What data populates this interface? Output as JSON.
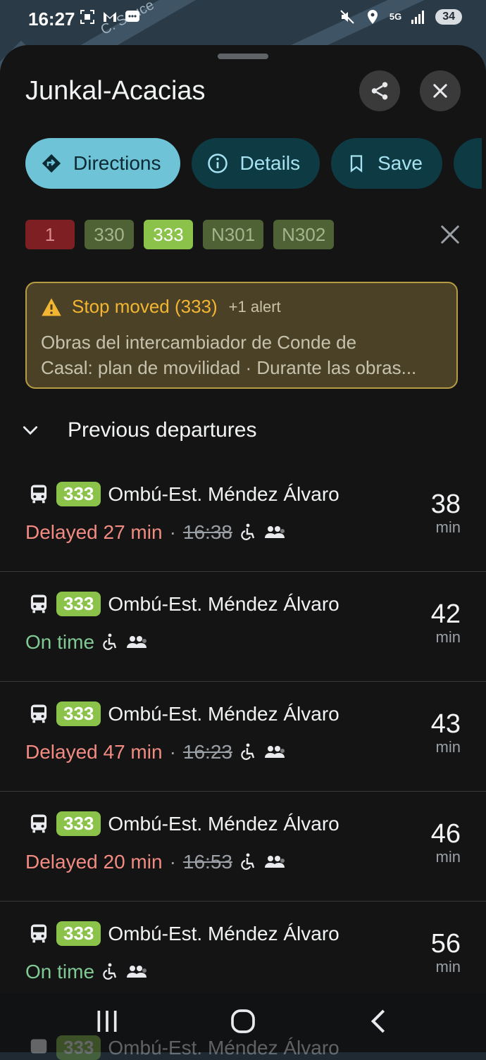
{
  "status_bar": {
    "time": "16:27",
    "network": "5G",
    "battery": "34"
  },
  "map": {
    "street_label": "C. Sauce"
  },
  "stop": {
    "title": "Junkal-Acacias"
  },
  "actions": {
    "directions": "Directions",
    "details": "Details",
    "save": "Save"
  },
  "routes": [
    {
      "label": "1",
      "bg": "#7d1f23",
      "fg": "#d98a8e"
    },
    {
      "label": "330",
      "bg": "#4f6236",
      "fg": "#a5b58b"
    },
    {
      "label": "333",
      "bg": "#8bc34a",
      "fg": "#ffffff"
    },
    {
      "label": "N301",
      "bg": "#4f6236",
      "fg": "#a5b58b"
    },
    {
      "label": "N302",
      "bg": "#4f6236",
      "fg": "#a5b58b"
    }
  ],
  "alert": {
    "title": "Stop moved (333)",
    "extra": "+1 alert",
    "line1": "Obras del intercambiador de Conde de",
    "line2": "Casal: plan de movilidad · Durante las obras..."
  },
  "section": {
    "title": "Previous departures"
  },
  "departures": [
    {
      "route": "333",
      "dest": "Ombú-Est. Méndez Álvaro",
      "status": "Delayed 27 min",
      "status_type": "delayed",
      "dot": "·",
      "scheduled": "16:38",
      "eta": "38",
      "unit": "min"
    },
    {
      "route": "333",
      "dest": "Ombú-Est. Méndez Álvaro",
      "status": "On time",
      "status_type": "ontime",
      "eta": "42",
      "unit": "min"
    },
    {
      "route": "333",
      "dest": "Ombú-Est. Méndez Álvaro",
      "status": "Delayed 47 min",
      "status_type": "delayed",
      "dot": "·",
      "scheduled": "16:23",
      "eta": "43",
      "unit": "min"
    },
    {
      "route": "333",
      "dest": "Ombú-Est. Méndez Álvaro",
      "status": "Delayed 20 min",
      "status_type": "delayed",
      "dot": "·",
      "scheduled": "16:53",
      "eta": "46",
      "unit": "min"
    },
    {
      "route": "333",
      "dest": "Ombú-Est. Méndez Álvaro",
      "status": "On time",
      "status_type": "ontime",
      "eta": "56",
      "unit": "min"
    }
  ],
  "partial_row": {
    "route": "333",
    "dest": "Ombú-Est. Méndez Álvaro"
  },
  "colors": {
    "accent": "#6fc3d6",
    "delayed": "#f28b82",
    "on_time": "#81c995",
    "route_333": "#8bc34a"
  },
  "icons": {
    "share": "share-icon",
    "close": "close-icon",
    "directions": "directions-icon",
    "details": "info-icon",
    "save": "bookmark-icon",
    "bus": "bus-icon",
    "accessible": "wheelchair-icon",
    "occupancy": "people-icon",
    "warning": "warning-icon"
  }
}
